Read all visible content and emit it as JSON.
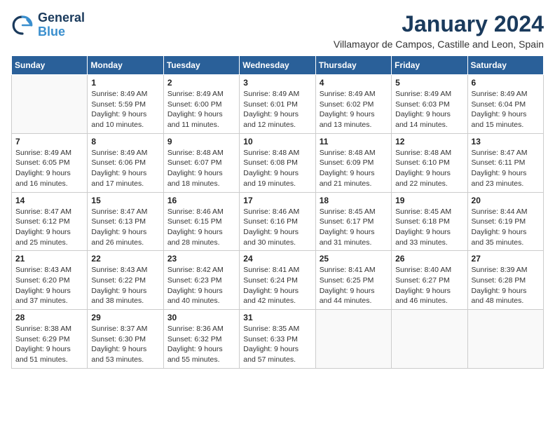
{
  "header": {
    "logo_line1": "General",
    "logo_line2": "Blue",
    "title": "January 2024",
    "subtitle": "Villamayor de Campos, Castille and Leon, Spain"
  },
  "days_of_week": [
    "Sunday",
    "Monday",
    "Tuesday",
    "Wednesday",
    "Thursday",
    "Friday",
    "Saturday"
  ],
  "weeks": [
    [
      {
        "day": "",
        "sunrise": "",
        "sunset": "",
        "daylight": ""
      },
      {
        "day": "1",
        "sunrise": "Sunrise: 8:49 AM",
        "sunset": "Sunset: 5:59 PM",
        "daylight": "Daylight: 9 hours and 10 minutes."
      },
      {
        "day": "2",
        "sunrise": "Sunrise: 8:49 AM",
        "sunset": "Sunset: 6:00 PM",
        "daylight": "Daylight: 9 hours and 11 minutes."
      },
      {
        "day": "3",
        "sunrise": "Sunrise: 8:49 AM",
        "sunset": "Sunset: 6:01 PM",
        "daylight": "Daylight: 9 hours and 12 minutes."
      },
      {
        "day": "4",
        "sunrise": "Sunrise: 8:49 AM",
        "sunset": "Sunset: 6:02 PM",
        "daylight": "Daylight: 9 hours and 13 minutes."
      },
      {
        "day": "5",
        "sunrise": "Sunrise: 8:49 AM",
        "sunset": "Sunset: 6:03 PM",
        "daylight": "Daylight: 9 hours and 14 minutes."
      },
      {
        "day": "6",
        "sunrise": "Sunrise: 8:49 AM",
        "sunset": "Sunset: 6:04 PM",
        "daylight": "Daylight: 9 hours and 15 minutes."
      }
    ],
    [
      {
        "day": "7",
        "sunrise": "Sunrise: 8:49 AM",
        "sunset": "Sunset: 6:05 PM",
        "daylight": "Daylight: 9 hours and 16 minutes."
      },
      {
        "day": "8",
        "sunrise": "Sunrise: 8:49 AM",
        "sunset": "Sunset: 6:06 PM",
        "daylight": "Daylight: 9 hours and 17 minutes."
      },
      {
        "day": "9",
        "sunrise": "Sunrise: 8:48 AM",
        "sunset": "Sunset: 6:07 PM",
        "daylight": "Daylight: 9 hours and 18 minutes."
      },
      {
        "day": "10",
        "sunrise": "Sunrise: 8:48 AM",
        "sunset": "Sunset: 6:08 PM",
        "daylight": "Daylight: 9 hours and 19 minutes."
      },
      {
        "day": "11",
        "sunrise": "Sunrise: 8:48 AM",
        "sunset": "Sunset: 6:09 PM",
        "daylight": "Daylight: 9 hours and 21 minutes."
      },
      {
        "day": "12",
        "sunrise": "Sunrise: 8:48 AM",
        "sunset": "Sunset: 6:10 PM",
        "daylight": "Daylight: 9 hours and 22 minutes."
      },
      {
        "day": "13",
        "sunrise": "Sunrise: 8:47 AM",
        "sunset": "Sunset: 6:11 PM",
        "daylight": "Daylight: 9 hours and 23 minutes."
      }
    ],
    [
      {
        "day": "14",
        "sunrise": "Sunrise: 8:47 AM",
        "sunset": "Sunset: 6:12 PM",
        "daylight": "Daylight: 9 hours and 25 minutes."
      },
      {
        "day": "15",
        "sunrise": "Sunrise: 8:47 AM",
        "sunset": "Sunset: 6:13 PM",
        "daylight": "Daylight: 9 hours and 26 minutes."
      },
      {
        "day": "16",
        "sunrise": "Sunrise: 8:46 AM",
        "sunset": "Sunset: 6:15 PM",
        "daylight": "Daylight: 9 hours and 28 minutes."
      },
      {
        "day": "17",
        "sunrise": "Sunrise: 8:46 AM",
        "sunset": "Sunset: 6:16 PM",
        "daylight": "Daylight: 9 hours and 30 minutes."
      },
      {
        "day": "18",
        "sunrise": "Sunrise: 8:45 AM",
        "sunset": "Sunset: 6:17 PM",
        "daylight": "Daylight: 9 hours and 31 minutes."
      },
      {
        "day": "19",
        "sunrise": "Sunrise: 8:45 AM",
        "sunset": "Sunset: 6:18 PM",
        "daylight": "Daylight: 9 hours and 33 minutes."
      },
      {
        "day": "20",
        "sunrise": "Sunrise: 8:44 AM",
        "sunset": "Sunset: 6:19 PM",
        "daylight": "Daylight: 9 hours and 35 minutes."
      }
    ],
    [
      {
        "day": "21",
        "sunrise": "Sunrise: 8:43 AM",
        "sunset": "Sunset: 6:20 PM",
        "daylight": "Daylight: 9 hours and 37 minutes."
      },
      {
        "day": "22",
        "sunrise": "Sunrise: 8:43 AM",
        "sunset": "Sunset: 6:22 PM",
        "daylight": "Daylight: 9 hours and 38 minutes."
      },
      {
        "day": "23",
        "sunrise": "Sunrise: 8:42 AM",
        "sunset": "Sunset: 6:23 PM",
        "daylight": "Daylight: 9 hours and 40 minutes."
      },
      {
        "day": "24",
        "sunrise": "Sunrise: 8:41 AM",
        "sunset": "Sunset: 6:24 PM",
        "daylight": "Daylight: 9 hours and 42 minutes."
      },
      {
        "day": "25",
        "sunrise": "Sunrise: 8:41 AM",
        "sunset": "Sunset: 6:25 PM",
        "daylight": "Daylight: 9 hours and 44 minutes."
      },
      {
        "day": "26",
        "sunrise": "Sunrise: 8:40 AM",
        "sunset": "Sunset: 6:27 PM",
        "daylight": "Daylight: 9 hours and 46 minutes."
      },
      {
        "day": "27",
        "sunrise": "Sunrise: 8:39 AM",
        "sunset": "Sunset: 6:28 PM",
        "daylight": "Daylight: 9 hours and 48 minutes."
      }
    ],
    [
      {
        "day": "28",
        "sunrise": "Sunrise: 8:38 AM",
        "sunset": "Sunset: 6:29 PM",
        "daylight": "Daylight: 9 hours and 51 minutes."
      },
      {
        "day": "29",
        "sunrise": "Sunrise: 8:37 AM",
        "sunset": "Sunset: 6:30 PM",
        "daylight": "Daylight: 9 hours and 53 minutes."
      },
      {
        "day": "30",
        "sunrise": "Sunrise: 8:36 AM",
        "sunset": "Sunset: 6:32 PM",
        "daylight": "Daylight: 9 hours and 55 minutes."
      },
      {
        "day": "31",
        "sunrise": "Sunrise: 8:35 AM",
        "sunset": "Sunset: 6:33 PM",
        "daylight": "Daylight: 9 hours and 57 minutes."
      },
      {
        "day": "",
        "sunrise": "",
        "sunset": "",
        "daylight": ""
      },
      {
        "day": "",
        "sunrise": "",
        "sunset": "",
        "daylight": ""
      },
      {
        "day": "",
        "sunrise": "",
        "sunset": "",
        "daylight": ""
      }
    ]
  ]
}
